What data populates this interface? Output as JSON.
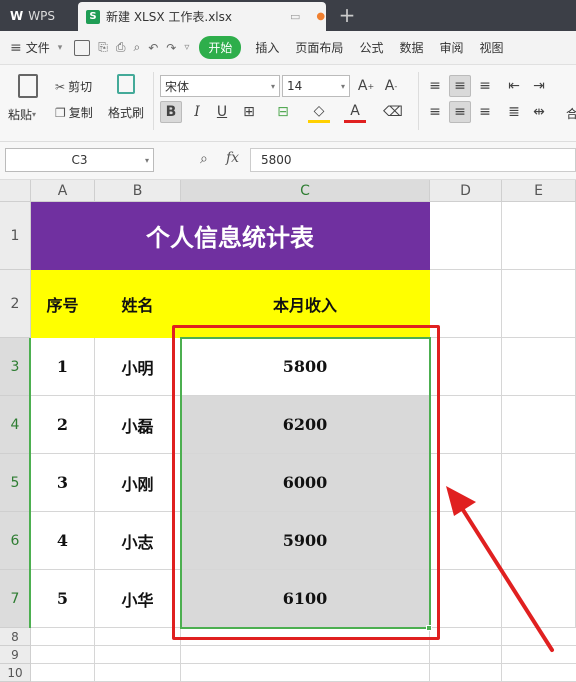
{
  "titlebar": {
    "app": "WPS",
    "file": "新建 XLSX 工作表.xlsx",
    "new_tab": "+"
  },
  "menu": {
    "file": "文件",
    "start": "开始",
    "items": [
      "插入",
      "页面布局",
      "公式",
      "数据",
      "审阅",
      "视图"
    ]
  },
  "ribbon": {
    "paste": "粘贴",
    "cut": "剪切",
    "copy": "复制",
    "format_painter": "格式刷",
    "font_name": "宋体",
    "font_size": "14",
    "bold": "B",
    "italic": "I",
    "underline": "U",
    "merge": "合"
  },
  "formula": {
    "cell_ref": "C3",
    "fx": "fx",
    "value": "5800"
  },
  "columns": [
    "A",
    "B",
    "C",
    "D",
    "E"
  ],
  "rows": [
    "1",
    "2",
    "3",
    "4",
    "5",
    "6",
    "7",
    "8",
    "9",
    "10"
  ],
  "sheet": {
    "title": "个人信息统计表",
    "headers": [
      "序号",
      "姓名",
      "本月收入"
    ],
    "data": [
      [
        "1",
        "小明",
        "5800"
      ],
      [
        "2",
        "小磊",
        "6200"
      ],
      [
        "3",
        "小刚",
        "6000"
      ],
      [
        "4",
        "小志",
        "5900"
      ],
      [
        "5",
        "小华",
        "6100"
      ]
    ]
  },
  "colors": {
    "title_bg": "#7030a0",
    "header_bg": "#ffff00",
    "selection_bg": "#d9d9d9",
    "selection_border": "#4caf50",
    "annotation_red": "#e02020"
  }
}
